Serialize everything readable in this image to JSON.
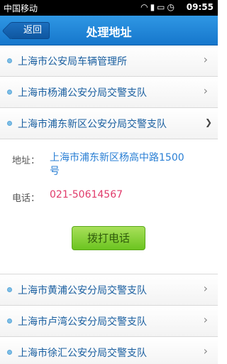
{
  "status_bar": {
    "carrier": "中国移动",
    "time": "09:55",
    "icons": [
      "wifi-icon",
      "signal-icon",
      "battery-icon",
      "alarm-icon"
    ]
  },
  "header": {
    "back_label": "返回",
    "title": "处理地址"
  },
  "offices_top": [
    {
      "label": "上海市公安局车辆管理所"
    },
    {
      "label": "上海市杨浦公安分局交警支队"
    }
  ],
  "expanded": {
    "label": "上海市浦东新区公安分局交警支队",
    "address_label": "地址：",
    "address": "上海市浦东新区杨高中路1500号",
    "phone_label": "电话：",
    "phone": "021-50614567",
    "call_label": "拨打电话"
  },
  "offices_bottom": [
    {
      "label": "上海市黄浦公安分局交警支队"
    },
    {
      "label": "上海市卢湾公安分局交警支队"
    },
    {
      "label": "上海市徐汇公安分局交警支队"
    }
  ],
  "colors": {
    "header": "#1f87d8",
    "link_text": "#1a5fa0",
    "address_text": "#2a7fd4",
    "phone_text": "#e03a6a",
    "call_button": "#8bd23a"
  }
}
